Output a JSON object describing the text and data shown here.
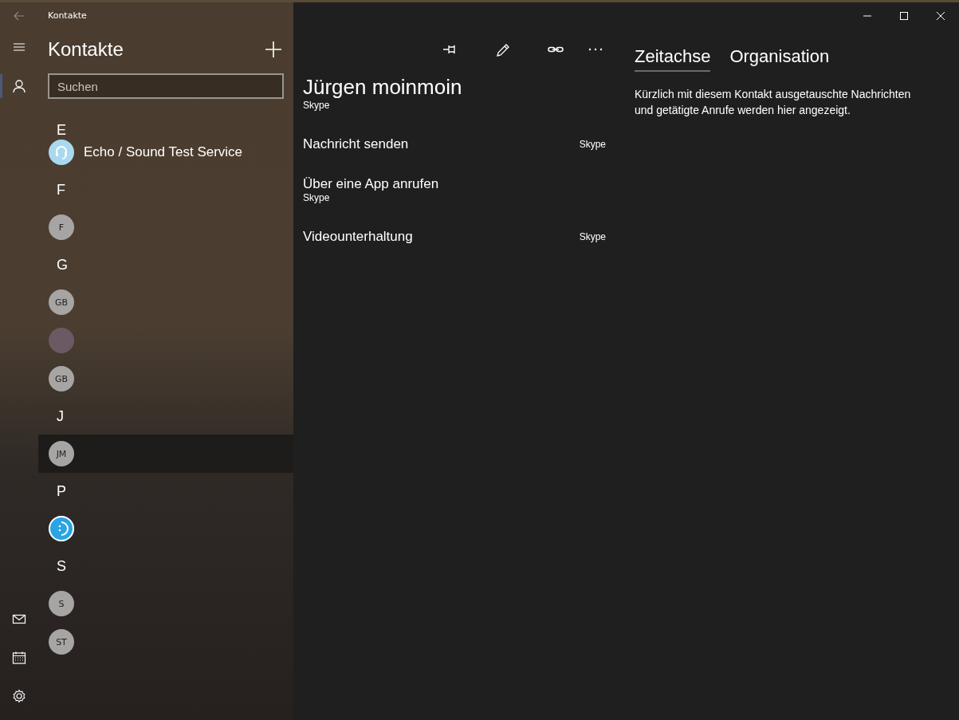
{
  "window": {
    "title": "Kontakte"
  },
  "nav": {
    "top": [
      {
        "kind": "menu",
        "selected": false
      },
      {
        "kind": "people",
        "selected": true
      }
    ],
    "bottom": [
      {
        "kind": "mail"
      },
      {
        "kind": "calendar"
      },
      {
        "kind": "settings"
      }
    ]
  },
  "contacts": {
    "title": "Kontakte",
    "search": {
      "placeholder": "Suchen"
    },
    "groups": [
      {
        "letter": "E",
        "items": [
          {
            "kind": "headset",
            "name": "Echo / Sound Test Service",
            "selected": false
          }
        ]
      },
      {
        "letter": "F",
        "items": [
          {
            "kind": "initials",
            "initials": "F",
            "selected": false
          }
        ]
      },
      {
        "letter": "G",
        "items": [
          {
            "kind": "initials",
            "initials": "GB",
            "selected": false
          },
          {
            "kind": "photo",
            "selected": false
          },
          {
            "kind": "initials",
            "initials": "GB",
            "selected": false
          }
        ]
      },
      {
        "letter": "J",
        "items": [
          {
            "kind": "initials",
            "initials": "JM",
            "selected": true
          }
        ]
      },
      {
        "letter": "P",
        "items": [
          {
            "kind": "smiley",
            "selected": false
          }
        ]
      },
      {
        "letter": "S",
        "items": [
          {
            "kind": "initials",
            "initials": "S",
            "selected": false
          },
          {
            "kind": "initials",
            "initials": "ST",
            "selected": false
          }
        ]
      }
    ]
  },
  "detail": {
    "toolbar": [
      {
        "kind": "pin"
      },
      {
        "kind": "edit"
      },
      {
        "kind": "link"
      },
      {
        "kind": "more"
      }
    ],
    "name": "Jürgen moinmoin",
    "source": "Skype",
    "actions": [
      {
        "label": "Nachricht senden",
        "app": "Skype",
        "kind": "side"
      },
      {
        "label": "Über eine App anrufen",
        "app": "Skype",
        "kind": "below"
      },
      {
        "label": "Videounterhaltung",
        "app": "Skype",
        "kind": "side"
      }
    ]
  },
  "timeline": {
    "tabs": [
      {
        "label": "Zeitachse",
        "selected": true
      },
      {
        "label": "Organisation",
        "selected": false
      }
    ],
    "message": "Kürzlich mit diesem Kontakt ausgetauschte Nachrichten und getätigte Anrufe werden hier angezeigt."
  }
}
